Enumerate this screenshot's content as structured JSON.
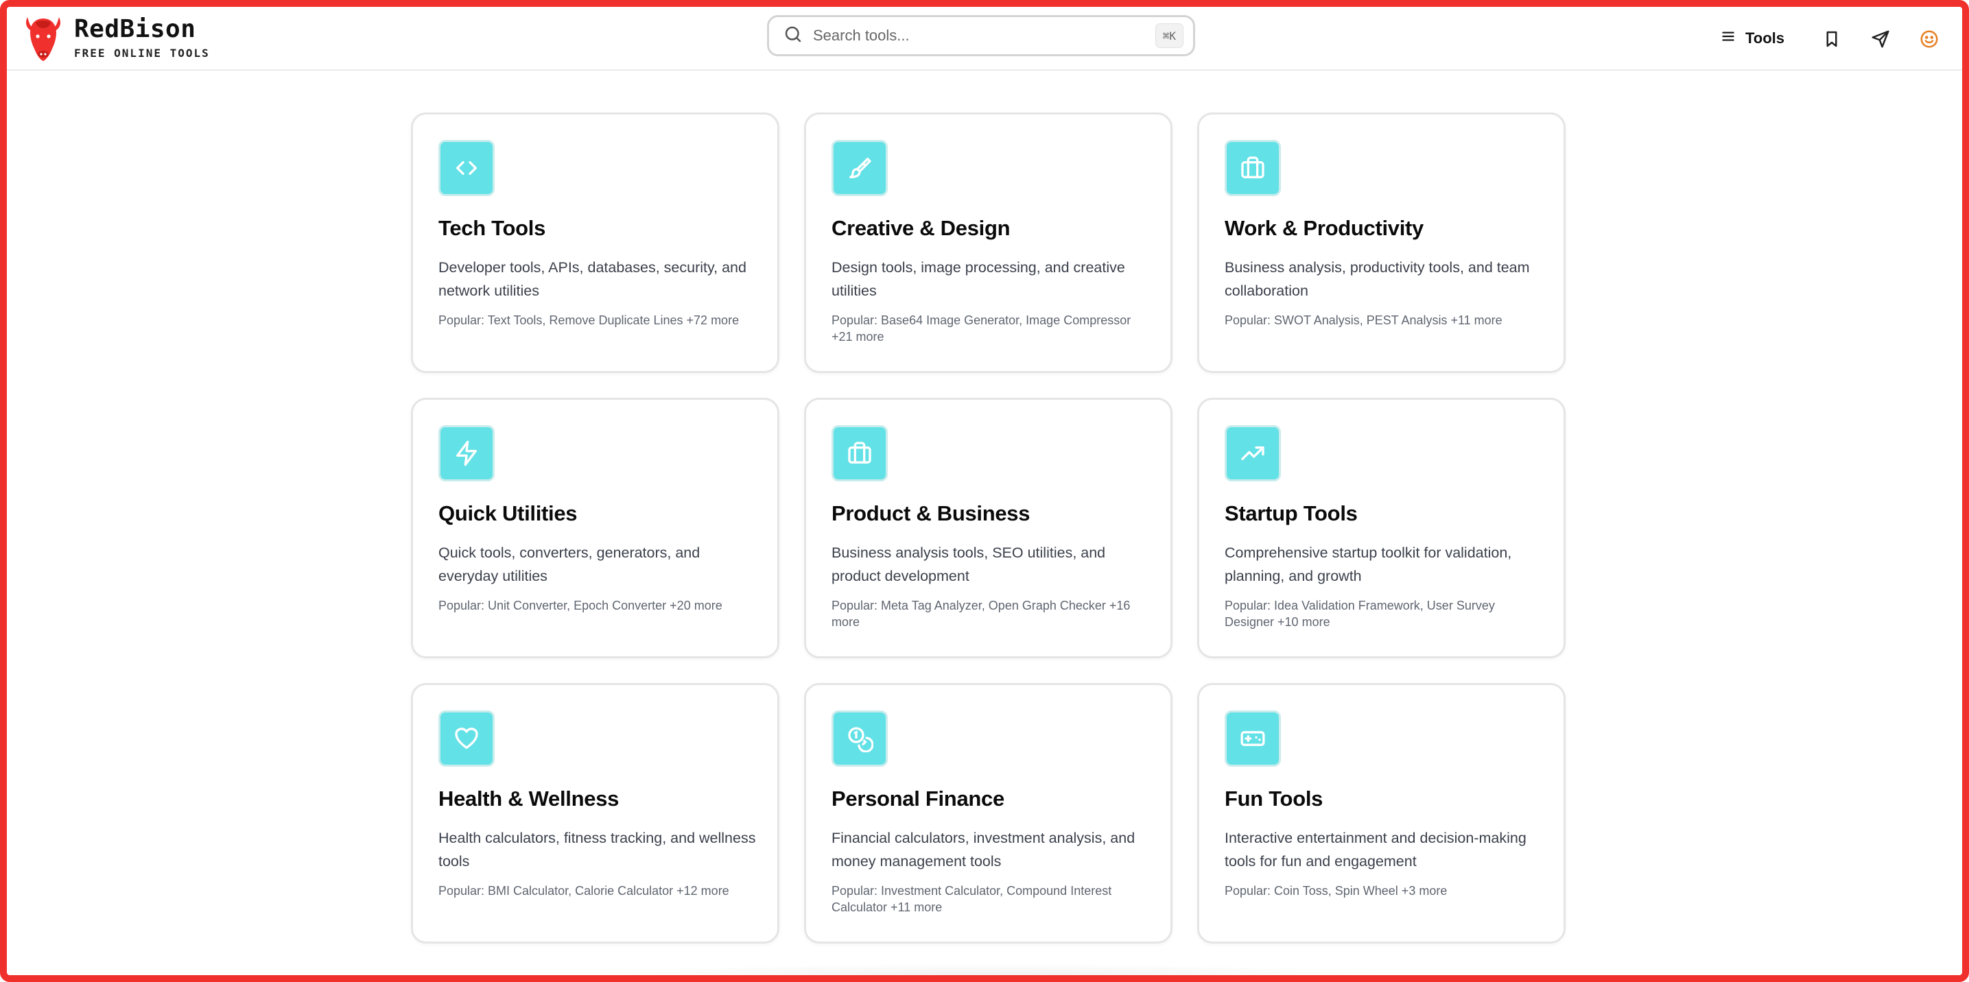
{
  "brand": {
    "name": "RedBison",
    "tagline": "FREE ONLINE TOOLS",
    "logo_icon": "bison-head-icon",
    "color": "#f0302c"
  },
  "search": {
    "placeholder": "Search tools...",
    "shortcut": "⌘K"
  },
  "nav": {
    "tools_label": "Tools",
    "icons": [
      "menu-icon",
      "bookmark-icon",
      "send-icon",
      "smiley-icon"
    ],
    "smiley_color": "#e67e22"
  },
  "colors": {
    "accent_tile": "#62e1e6",
    "frame_border": "#f0302c"
  },
  "categories": [
    {
      "title": "Tech Tools",
      "icon": "code-brackets-icon",
      "description": "Developer tools, APIs, databases, security, and network utilities",
      "popular": "Popular: Text Tools, Remove Duplicate Lines +72 more"
    },
    {
      "title": "Creative & Design",
      "icon": "paintbrush-icon",
      "description": "Design tools, image processing, and creative utilities",
      "popular": "Popular: Base64 Image Generator, Image Compressor +21 more"
    },
    {
      "title": "Work & Productivity",
      "icon": "briefcase-icon",
      "description": "Business analysis, productivity tools, and team collaboration",
      "popular": "Popular: SWOT Analysis, PEST Analysis +11 more"
    },
    {
      "title": "Quick Utilities",
      "icon": "lightning-icon",
      "description": "Quick tools, converters, generators, and everyday utilities",
      "popular": "Popular: Unit Converter, Epoch Converter +20 more"
    },
    {
      "title": "Product & Business",
      "icon": "briefcase-icon",
      "description": "Business analysis tools, SEO utilities, and product development",
      "popular": "Popular: Meta Tag Analyzer, Open Graph Checker +16 more"
    },
    {
      "title": "Startup Tools",
      "icon": "trending-up-icon",
      "description": "Comprehensive startup toolkit for validation, planning, and growth",
      "popular": "Popular: Idea Validation Framework, User Survey Designer +10 more"
    },
    {
      "title": "Health & Wellness",
      "icon": "heart-icon",
      "description": "Health calculators, fitness tracking, and wellness tools",
      "popular": "Popular: BMI Calculator, Calorie Calculator +12 more"
    },
    {
      "title": "Personal Finance",
      "icon": "coins-icon",
      "description": "Financial calculators, investment analysis, and money management tools",
      "popular": "Popular: Investment Calculator, Compound Interest Calculator +11 more"
    },
    {
      "title": "Fun Tools",
      "icon": "gamepad-icon",
      "description": "Interactive entertainment and decision-making tools for fun and engagement",
      "popular": "Popular: Coin Toss, Spin Wheel +3 more"
    }
  ]
}
